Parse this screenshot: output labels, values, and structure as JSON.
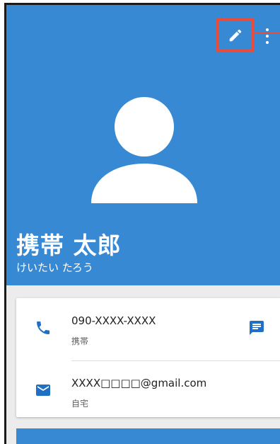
{
  "contact": {
    "name": "携帯 太郎",
    "reading": "けいたい たろう"
  },
  "phone": {
    "number": "090-XXXX-XXXX",
    "label": "携帯"
  },
  "email": {
    "address": "XXXX□□□□@gmail.com",
    "label": "自宅"
  },
  "icons": {
    "edit": "pencil-icon",
    "more": "more-vert-icon",
    "avatar": "person-icon",
    "phone": "phone-icon",
    "message": "message-icon",
    "email": "email-icon"
  },
  "colors": {
    "header": "#3889d4",
    "accent": "#1f6fc5",
    "highlight": "#e74c3c"
  }
}
